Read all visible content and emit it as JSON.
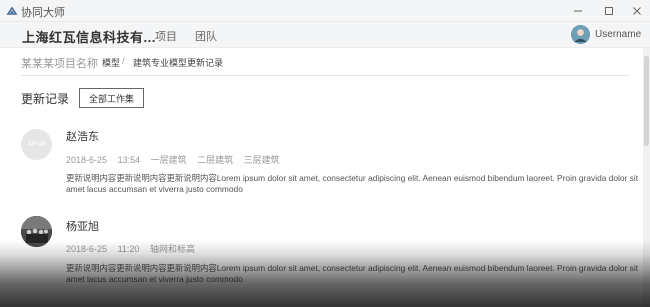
{
  "window": {
    "app_name": "协同大师",
    "icons": {
      "logo": "app-logo-icon",
      "minimize": "minimize-icon",
      "maximize": "maximize-icon",
      "close": "close-icon"
    }
  },
  "header": {
    "company": "上海红瓦信息科技有...",
    "nav": [
      "项目",
      "团队"
    ],
    "username": "Username"
  },
  "breadcrumb": {
    "project": "某某某项目名称",
    "model": "模型",
    "separator": "/",
    "current": "建筑专业模型更新记录"
  },
  "section": {
    "title": "更新记录",
    "filter_button": "全部工作集"
  },
  "records": [
    {
      "name": "赵浩东",
      "avatar_text": "48*48",
      "date": "2018-6-25",
      "time": "13:54",
      "tags": [
        "一层建筑",
        "二层建筑",
        "三层建筑"
      ],
      "description": "更新说明内容更新说明内容更新说明内容Lorem ipsum dolor sit amet, consectetur adipiscing elit. Aenean euismod bibendum laoreet. Proin gravida dolor sit amet lacus accumsan et viverra justo commodo"
    },
    {
      "name": "杨亚旭",
      "avatar_text": "",
      "date": "2018-6-25",
      "time": "11:20",
      "tags": [
        "轴网和标高"
      ],
      "description": "更新说明内容更新说明内容更新说明内容Lorem ipsum dolor sit amet, consectetur adipiscing elit. Aenean euismod bibendum laoreet. Proin gravida dolor sit amet lacus accumsan et viverra justo commodo"
    }
  ],
  "colors": {
    "titlebar_bg": "#f4f5f7",
    "text_primary": "#333333",
    "text_muted": "#999999"
  }
}
